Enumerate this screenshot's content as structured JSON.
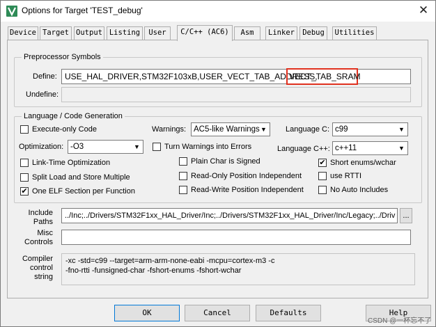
{
  "window": {
    "title": "Options for Target 'TEST_debug'",
    "close_glyph": "✕"
  },
  "tabs": [
    {
      "label": "Device"
    },
    {
      "label": "Target"
    },
    {
      "label": "Output"
    },
    {
      "label": "Listing"
    },
    {
      "label": "User"
    },
    {
      "label": "C/C++ (AC6)"
    },
    {
      "label": "Asm"
    },
    {
      "label": "Linker"
    },
    {
      "label": "Debug"
    },
    {
      "label": "Utilities"
    }
  ],
  "active_tab": "C/C++ (AC6)",
  "preprocessor": {
    "group_title": "Preprocessor Symbols",
    "define_label": "Define:",
    "define_value_main": "USE_HAL_DRIVER,STM32F103xB,USER_VECT_TAB_ADDRESS,",
    "define_value_highlight": "VECT_TAB_SRAM",
    "undefine_label": "Undefine:",
    "undefine_value": ""
  },
  "language": {
    "group_title": "Language / Code Generation",
    "execute_only": {
      "label": "Execute-only Code",
      "checked": false
    },
    "warnings_label": "Warnings:",
    "warnings_value": "AC5-like Warnings",
    "language_c_label": "Language C:",
    "language_c_value": "c99",
    "optimization_label": "Optimization:",
    "optimization_value": "-O3",
    "turn_warnings": {
      "label": "Turn Warnings into Errors",
      "checked": false
    },
    "language_cpp_label": "Language C++:",
    "language_cpp_value": "c++11",
    "link_time": {
      "label": "Link-Time Optimization",
      "checked": false
    },
    "plain_char": {
      "label": "Plain Char is Signed",
      "checked": false
    },
    "short_enums": {
      "label": "Short enums/wchar",
      "checked": true
    },
    "split_load": {
      "label": "Split Load and Store Multiple",
      "checked": false
    },
    "readonly_pi": {
      "label": "Read-Only Position Independent",
      "checked": false
    },
    "use_rtti": {
      "label": "use RTTI",
      "checked": false
    },
    "one_elf": {
      "label": "One ELF Section per Function",
      "checked": true
    },
    "readwrite_pi": {
      "label": "Read-Write Position Independent",
      "checked": false
    },
    "no_auto_includes": {
      "label": "No Auto Includes",
      "checked": false
    }
  },
  "include_paths": {
    "label_line1": "Include",
    "label_line2": "Paths",
    "value": "../Inc;../Drivers/STM32F1xx_HAL_Driver/Inc;../Drivers/STM32F1xx_HAL_Driver/Inc/Legacy;../Driv",
    "browse_label": "..."
  },
  "misc_controls": {
    "label_line1": "Misc",
    "label_line2": "Controls",
    "value": ""
  },
  "compiler_string": {
    "label_line1": "Compiler",
    "label_line2": "control",
    "label_line3": "string",
    "line1": "-xc -std=c99 --target=arm-arm-none-eabi -mcpu=cortex-m3 -c",
    "line2": "-fno-rtti -funsigned-char -fshort-enums -fshort-wchar"
  },
  "buttons": {
    "ok": "OK",
    "cancel": "Cancel",
    "defaults": "Defaults",
    "help": "Help"
  },
  "watermark": "CSDN @一杯忘不了",
  "colors": {
    "highlight": "#e0301e",
    "default_button_border": "#0078d7"
  }
}
